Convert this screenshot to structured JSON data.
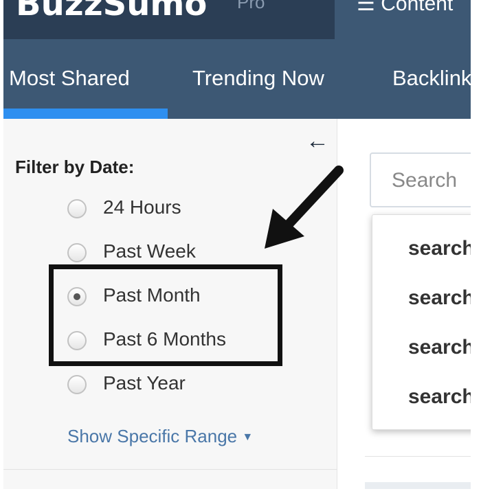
{
  "header": {
    "logo": "BuzzSumo",
    "plan": "Pro",
    "content_link": "Content"
  },
  "nav": {
    "tabs": [
      {
        "label": "Most Shared",
        "active": true
      },
      {
        "label": "Trending Now",
        "active": false
      },
      {
        "label": "Backlinks",
        "active": false
      }
    ],
    "accent_color": "#2e8ff0",
    "bar_color": "#3d5874"
  },
  "sidebar": {
    "collapse_icon": "arrow-left-icon",
    "filter_title": "Filter by Date:",
    "options": [
      {
        "label": "24 Hours",
        "selected": false
      },
      {
        "label": "Past Week",
        "selected": false
      },
      {
        "label": "Past Month",
        "selected": true
      },
      {
        "label": "Past 6 Months",
        "selected": false
      },
      {
        "label": "Past Year",
        "selected": false
      }
    ],
    "specific_range_link": "Show Specific Range"
  },
  "search": {
    "placeholder": "Search",
    "suggestions": [
      "search",
      "search",
      "search",
      "search"
    ]
  }
}
